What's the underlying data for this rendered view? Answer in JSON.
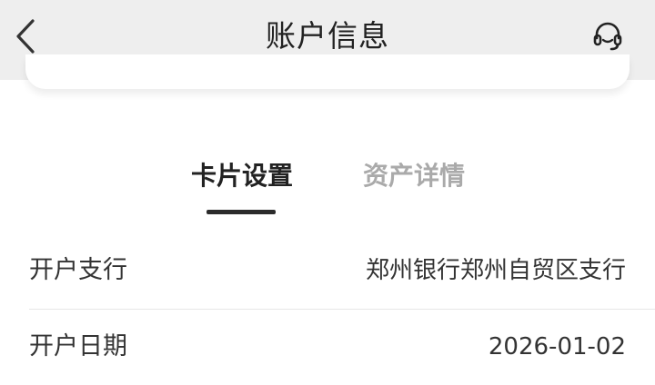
{
  "header": {
    "title": "账户信息",
    "back_icon": "chevron-left-icon",
    "service_icon": "headset-icon"
  },
  "tabs": [
    {
      "label": "卡片设置",
      "active": true
    },
    {
      "label": "资产详情",
      "active": false
    }
  ],
  "info_rows": [
    {
      "label": "开户支行",
      "value": "郑州银行郑州自贸区支行"
    },
    {
      "label": "开户日期",
      "value": "2026-01-02"
    }
  ],
  "colors": {
    "header_bg": "#eeeeee",
    "active_tab": "#222222",
    "inactive_tab": "#aaaaaa",
    "indicator": "#2b2b2b"
  }
}
